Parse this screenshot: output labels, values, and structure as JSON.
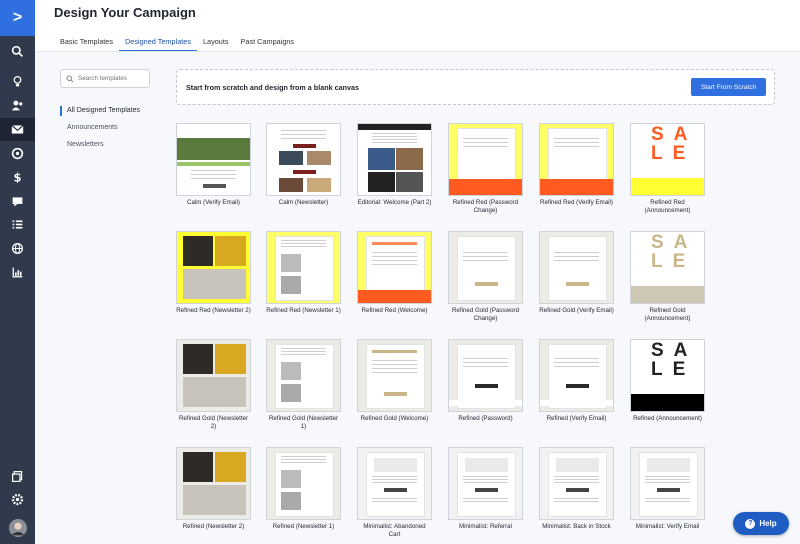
{
  "page": {
    "title": "Design Your Campaign"
  },
  "tabs": [
    {
      "label": "Basic Templates",
      "active": false
    },
    {
      "label": "Designed Templates",
      "active": true
    },
    {
      "label": "Layouts",
      "active": false
    },
    {
      "label": "Past Campaigns",
      "active": false
    }
  ],
  "nav_rail": {
    "logo_glyph": ">",
    "icons": [
      "search-icon",
      "lightbulb-icon",
      "contacts-icon",
      "mail-icon",
      "automation-icon",
      "dollar-icon",
      "chat-icon",
      "list-icon",
      "globe-icon",
      "reports-icon",
      "copy-icon",
      "gear-icon",
      "avatar"
    ],
    "active": "mail-icon"
  },
  "search": {
    "placeholder": "Search templates"
  },
  "sidebar": {
    "items": [
      {
        "label": "All Designed Templates",
        "active": true
      },
      {
        "label": "Announcements",
        "active": false
      },
      {
        "label": "Newsletters",
        "active": false
      }
    ]
  },
  "scratch": {
    "text": "Start from scratch and design from a blank canvas",
    "button_label": "Start From Scratch"
  },
  "templates": [
    {
      "name": "Calm (Verify Email)"
    },
    {
      "name": "Calm (Newsletter)"
    },
    {
      "name": "Editorial: Welcome (Part 2)"
    },
    {
      "name": "Refined Red (Password Change)"
    },
    {
      "name": "Refined Red (Verify Email)"
    },
    {
      "name": "Refined Red (Announcement)"
    },
    {
      "name": "Refined Red (Newsletter 2)"
    },
    {
      "name": "Refined Red (Newsletter 1)"
    },
    {
      "name": "Refined Red (Welcome)"
    },
    {
      "name": "Refined Gold (Password Change)"
    },
    {
      "name": "Refined Gold (Verify Email)"
    },
    {
      "name": "Refined Gold (Announcement)"
    },
    {
      "name": "Refined Gold (Newsletter 2)"
    },
    {
      "name": "Refined Gold (Newsletter 1)"
    },
    {
      "name": "Refined Gold (Welcome)"
    },
    {
      "name": "Refined (Password)"
    },
    {
      "name": "Refined (Verify Email)"
    },
    {
      "name": "Refined (Announcement)"
    },
    {
      "name": "Refined (Newsletter 2)"
    },
    {
      "name": "Refined (Newsletter 1)"
    },
    {
      "name": "Minimalist: Abandoned Cart"
    },
    {
      "name": "Minimalist: Referral"
    },
    {
      "name": "Minimalist: Back in Stock"
    },
    {
      "name": "Minimalist: Verify Email"
    }
  ],
  "sale_letters": [
    "S",
    "A",
    "L",
    "E"
  ],
  "help": {
    "label": "Help",
    "glyph": "?"
  },
  "colors": {
    "accent": "#2f6fe0",
    "rail": "#313a4d",
    "red": "#ff5a1f",
    "yellow": "#ffff66",
    "gold": "#c9b68a"
  }
}
